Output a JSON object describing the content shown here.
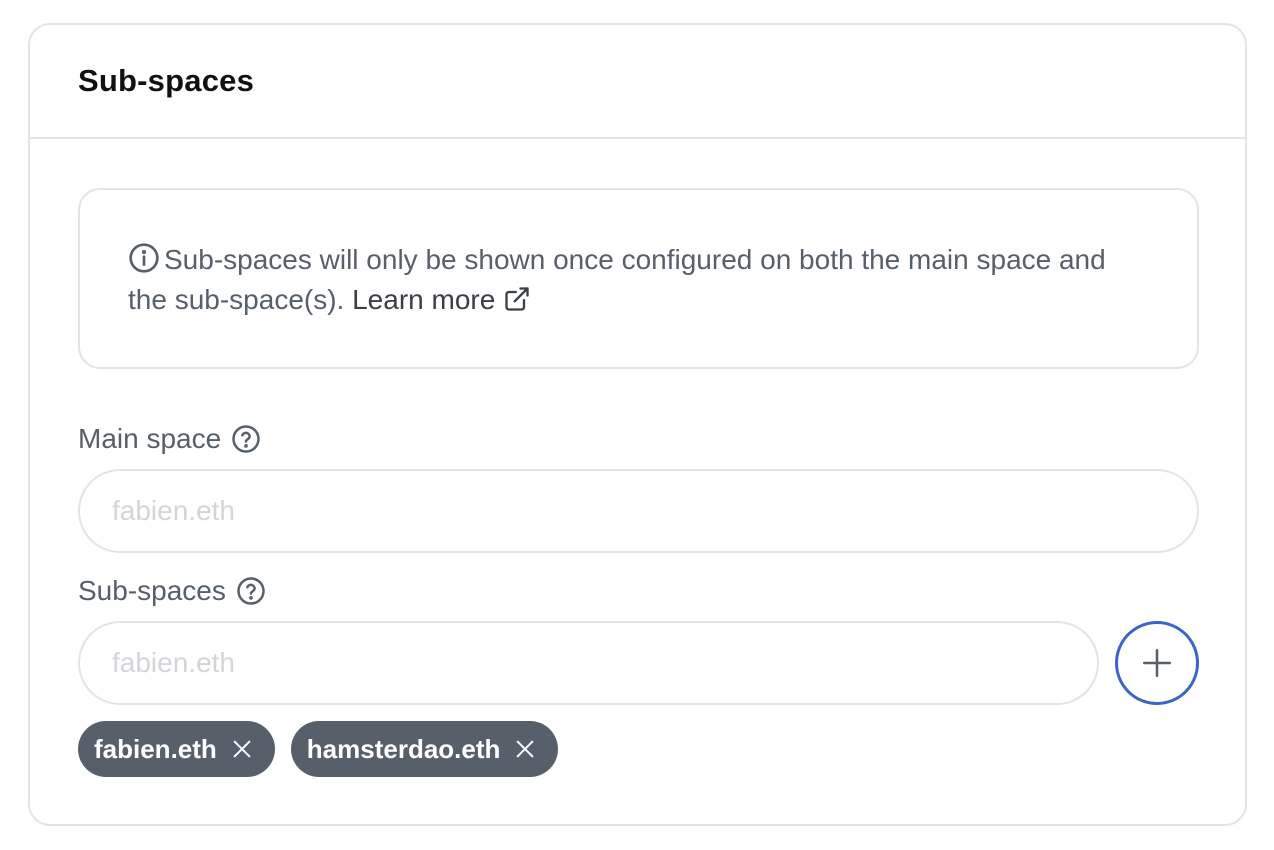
{
  "card": {
    "title": "Sub-spaces"
  },
  "notice": {
    "text": "Sub-spaces will only be shown once configured on both the main space and the sub-space(s).",
    "link_label": "Learn more",
    "icon": "info-circle-icon",
    "link_icon": "external-link-icon"
  },
  "main_space": {
    "label": "Main space",
    "placeholder": "fabien.eth",
    "value": "",
    "help_icon": "question-circle-icon"
  },
  "sub_spaces": {
    "label": "Sub-spaces",
    "placeholder": "fabien.eth",
    "value": "",
    "help_icon": "question-circle-icon",
    "add_icon": "plus-icon",
    "tags": [
      {
        "label": "fabien.eth",
        "remove_icon": "close-icon"
      },
      {
        "label": "hamsterdao.eth",
        "remove_icon": "close-icon"
      }
    ]
  },
  "colors": {
    "text": "#57606a",
    "heading": "#111111",
    "border": "#e2e4e8",
    "accent": "#3b66c4",
    "tag_bg": "#57606a",
    "placeholder": "#d3d5d9"
  }
}
